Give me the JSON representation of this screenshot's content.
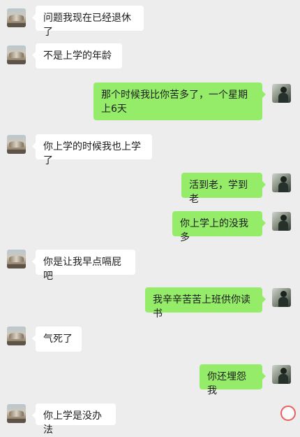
{
  "messages": [
    {
      "side": "in",
      "text": "问题我现在已经退休了"
    },
    {
      "side": "in",
      "text": "不是上学的年龄"
    },
    {
      "side": "out",
      "text": "那个时候我比你苦多了，一个星期上6天"
    },
    {
      "side": "in",
      "text": "你上学的时候我也上学了"
    },
    {
      "side": "out",
      "text": "活到老，学到老"
    },
    {
      "side": "out",
      "text": "你上学上的没我多"
    },
    {
      "side": "in",
      "text": "你是让我早点嗝屁吧"
    },
    {
      "side": "out",
      "text": "我辛辛苦苦上班供你读书"
    },
    {
      "side": "in",
      "text": "气死了"
    },
    {
      "side": "out",
      "text": "你还埋怨我"
    },
    {
      "side": "in",
      "text": "你上学是没办法"
    }
  ],
  "colors": {
    "background": "#ededed",
    "incoming_bubble": "#ffffff",
    "outgoing_bubble": "#95ec69"
  },
  "icons": {
    "friend_avatar": "avatar-landscape-icon",
    "self_avatar": "avatar-person-icon",
    "watermark": "weibo-logo-icon"
  }
}
